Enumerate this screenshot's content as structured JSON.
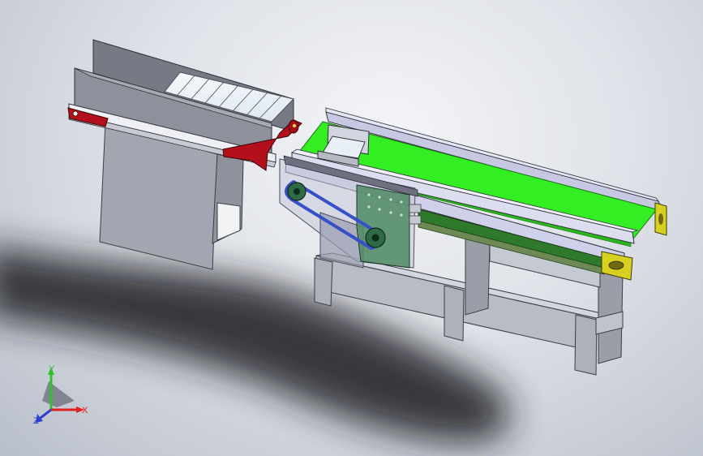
{
  "triad": {
    "x_label": "X",
    "y_label": "Y",
    "z_label": "Z",
    "x_color": "#e0201c",
    "y_color": "#2fbf2f",
    "z_color": "#2a3fd0"
  },
  "colors": {
    "belt_green": "#33ee22",
    "frame_lavender": "#cfd1ea",
    "frame_dark": "#6e7080",
    "panel_gray": "#a9acb6",
    "drive_cover": "#4f8a64",
    "drive_belt": "#3650c8",
    "red_bracket": "#b3101c",
    "yellow_endcap": "#d8d020",
    "background_center": "#f4f5f8",
    "background_edge": "#b9bfca"
  },
  "icons": {
    "triad": "coordinate-axes-triad-icon"
  }
}
